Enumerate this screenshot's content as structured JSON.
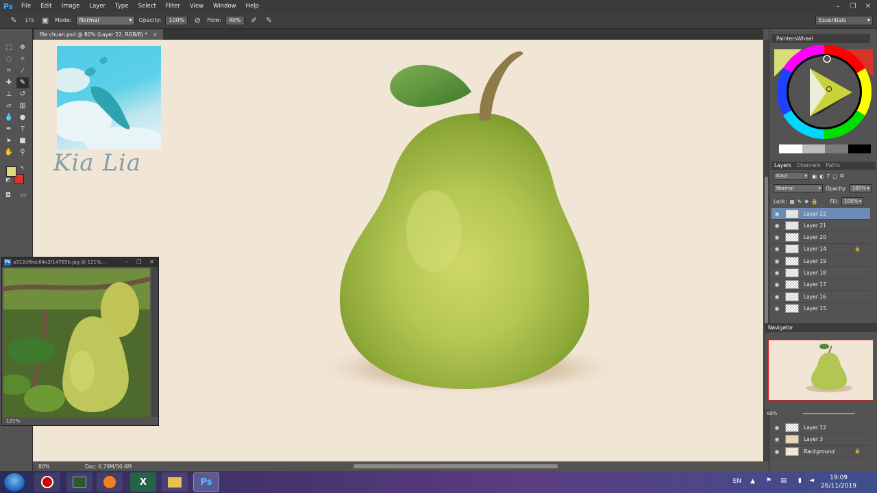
{
  "app": {
    "logo": "Ps"
  },
  "menu": [
    "File",
    "Edit",
    "Image",
    "Layer",
    "Type",
    "Select",
    "Filter",
    "View",
    "Window",
    "Help"
  ],
  "window_controls": [
    "–",
    "❐",
    "✕"
  ],
  "options": {
    "brush_size": "175",
    "mode_label": "Mode:",
    "mode_value": "Normal",
    "opacity_label": "Opacity:",
    "opacity_value": "100%",
    "flow_label": "Flow:",
    "flow_value": "40%",
    "workspace": "Essentials"
  },
  "document_tab": {
    "title": "file chuan.psd @ 80% (Layer 22, RGB/8) *",
    "close": "×"
  },
  "canvas": {
    "signature": "Kia Lia",
    "background_color": "#f1e6d6"
  },
  "float_window": {
    "title": "a312df0ac64a2f14765b.jpg @ 121%...",
    "controls": [
      "–",
      "❐",
      "✕"
    ],
    "zoom": "121%"
  },
  "status": {
    "zoom": "80%",
    "doc": "Doc: 6.79M/50.6M"
  },
  "panels": {
    "wheel_title": "PaintersWheel",
    "layer_tabs": [
      "Layers",
      "Channels",
      "Paths"
    ],
    "kind": "Kind",
    "blend_mode": "Normal",
    "opacity_label": "Opacity:",
    "opacity_value": "100%",
    "lock_label": "Lock:",
    "fill_label": "Fill:",
    "fill_value": "100%",
    "layers_top": [
      {
        "name": "Layer 22",
        "locked": false
      },
      {
        "name": "Layer 21",
        "locked": false
      },
      {
        "name": "Layer 20",
        "locked": false
      },
      {
        "name": "Layer 14",
        "locked": true
      },
      {
        "name": "Layer 19",
        "locked": false
      },
      {
        "name": "Layer 18",
        "locked": false
      },
      {
        "name": "Layer 17",
        "locked": false
      },
      {
        "name": "Layer 16",
        "locked": false
      },
      {
        "name": "Layer 15",
        "locked": false
      }
    ],
    "navigator_title": "Navigator",
    "navigator_zoom": "80%",
    "layers_bottom": [
      {
        "name": "Layer 12",
        "locked": false
      },
      {
        "name": "Layer 3",
        "locked": false
      },
      {
        "name": "Background",
        "locked": true
      }
    ]
  },
  "taskbar": {
    "lang": "EN",
    "time": "19:09",
    "date": "26/11/2019",
    "ps_label": "Ps",
    "excel_label": "X"
  },
  "colors": {
    "foreground": "#d9de7a",
    "background": "#d8352a",
    "accent_selected": "#6d8cb5"
  }
}
